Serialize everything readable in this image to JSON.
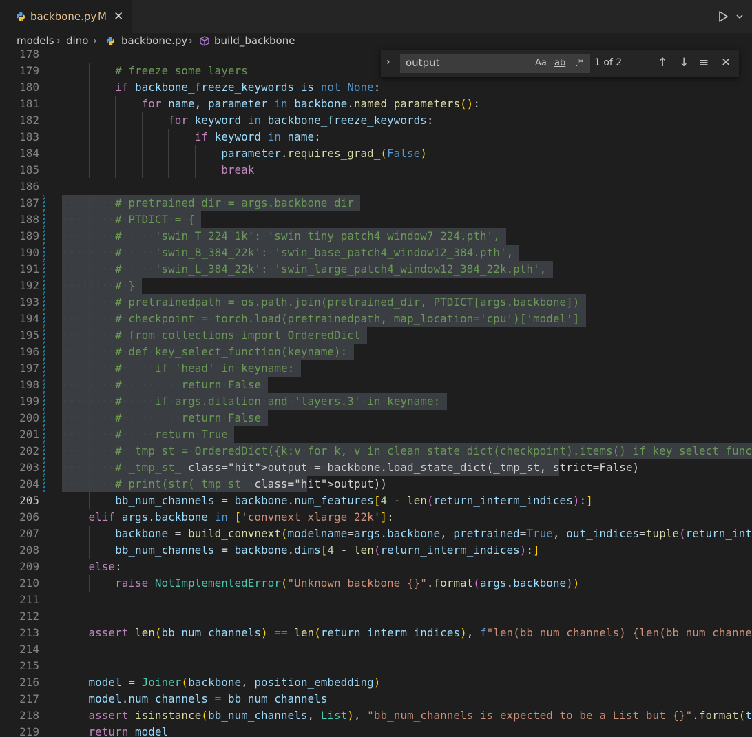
{
  "tab": {
    "filename": "backbone.py",
    "modified_flag": "M",
    "close_icon": "close-icon"
  },
  "breadcrumb": {
    "items": [
      "models",
      "dino",
      "backbone.py",
      "build_backbone"
    ]
  },
  "find_widget": {
    "query": "output",
    "match_case": "Aa",
    "whole_word": "ab",
    "regex": ".*",
    "result_count": "1 of 2"
  },
  "editor": {
    "active_line": 205,
    "lines": [
      {
        "n": "178",
        "t": ""
      },
      {
        "n": "179",
        "t": "# freeze some layers"
      },
      {
        "n": "180",
        "t": "if backbone_freeze_keywords is not None:"
      },
      {
        "n": "181",
        "t": "for name, parameter in backbone.named_parameters():"
      },
      {
        "n": "182",
        "t": "for keyword in backbone_freeze_keywords:"
      },
      {
        "n": "183",
        "t": "if keyword in name:"
      },
      {
        "n": "184",
        "t": "parameter.requires_grad_(False)"
      },
      {
        "n": "185",
        "t": "break"
      },
      {
        "n": "186",
        "t": ""
      },
      {
        "n": "187",
        "t": "# pretrained_dir = args.backbone_dir"
      },
      {
        "n": "188",
        "t": "# PTDICT = {"
      },
      {
        "n": "189",
        "t": "#     'swin_T_224_1k': 'swin_tiny_patch4_window7_224.pth',"
      },
      {
        "n": "190",
        "t": "#     'swin_B_384_22k': 'swin_base_patch4_window12_384.pth',"
      },
      {
        "n": "191",
        "t": "#     'swin_L_384_22k': 'swin_large_patch4_window12_384_22k.pth',"
      },
      {
        "n": "192",
        "t": "# }"
      },
      {
        "n": "193",
        "t": "# pretrainedpath = os.path.join(pretrained_dir, PTDICT[args.backbone])"
      },
      {
        "n": "194",
        "t": "# checkpoint = torch.load(pretrainedpath, map_location='cpu')['model']"
      },
      {
        "n": "195",
        "t": "# from collections import OrderedDict"
      },
      {
        "n": "196",
        "t": "# def key_select_function(keyname):"
      },
      {
        "n": "197",
        "t": "#     if 'head' in keyname:"
      },
      {
        "n": "198",
        "t": "#         return False"
      },
      {
        "n": "199",
        "t": "#     if args.dilation and 'layers.3' in keyname:"
      },
      {
        "n": "200",
        "t": "#         return False"
      },
      {
        "n": "201",
        "t": "#     return True"
      },
      {
        "n": "202",
        "t": "# _tmp_st = OrderedDict({k:v for k, v in clean_state_dict(checkpoint).items() if key_select_func"
      },
      {
        "n": "203",
        "t": "# _tmp_st_output = backbone.load_state_dict(_tmp_st, strict=False)"
      },
      {
        "n": "204",
        "t": "# print(str(_tmp_st_output))"
      },
      {
        "n": "205",
        "t": "bb_num_channels = backbone.num_features[4 - len(return_interm_indices):]"
      },
      {
        "n": "206",
        "t": "elif args.backbone in ['convnext_xlarge_22k']:"
      },
      {
        "n": "207",
        "t": "backbone = build_convnext(modelname=args.backbone, pretrained=True, out_indices=tuple(return_inte"
      },
      {
        "n": "208",
        "t": "bb_num_channels = backbone.dims[4 - len(return_interm_indices):]"
      },
      {
        "n": "209",
        "t": "else:"
      },
      {
        "n": "210",
        "t": "raise NotImplementedError(\"Unknown backbone {}\".format(args.backbone))"
      },
      {
        "n": "211",
        "t": ""
      },
      {
        "n": "212",
        "t": ""
      },
      {
        "n": "213",
        "t": "assert len(bb_num_channels) == len(return_interm_indices), f\"len(bb_num_channels) {len(bb_num_channe"
      },
      {
        "n": "214",
        "t": ""
      },
      {
        "n": "215",
        "t": ""
      },
      {
        "n": "216",
        "t": "model = Joiner(backbone, position_embedding)"
      },
      {
        "n": "217",
        "t": "model.num_channels = bb_num_channels"
      },
      {
        "n": "218",
        "t": "assert isinstance(bb_num_channels, List), \"bb_num_channels is expected to be a List but {}\".format(t"
      },
      {
        "n": "219",
        "t": "return model"
      },
      {
        "n": "220",
        "t": ""
      }
    ]
  }
}
